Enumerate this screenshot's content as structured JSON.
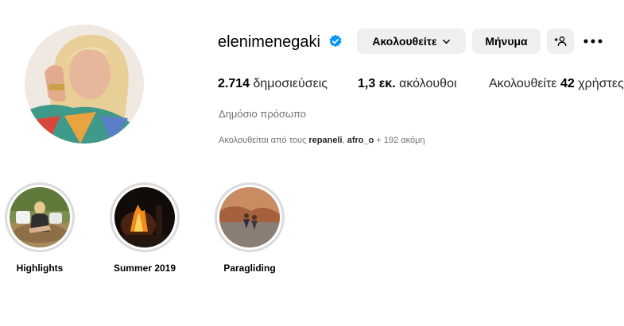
{
  "profile": {
    "username": "elenimenegaki",
    "verified": true,
    "accent_color": "#0095f6",
    "avatar_icon": "profile-photo"
  },
  "actions": {
    "follow_label": "Ακολουθείτε",
    "message_label": "Μήνυμα",
    "add_user_icon": "person-add-icon",
    "more_icon": "more-options-icon"
  },
  "stats": {
    "posts_count": "2.714",
    "posts_label": "δημοσιεύσεις",
    "followers_count": "1,3 εκ.",
    "followers_label": "ακόλουθοι",
    "following_prefix": "Ακολουθείτε",
    "following_count": "42",
    "following_label": "χρήστες"
  },
  "bio": {
    "category": "Δημόσιο πρόσωπο",
    "followed_by_prefix": "Ακολουθείται από τους",
    "followed_by_user1": "repaneli",
    "followed_by_sep": ",",
    "followed_by_user2": "afro_o",
    "followed_by_suffix": "+ 192 ακόμη"
  },
  "highlights": [
    {
      "label": "Highlights"
    },
    {
      "label": "Summer 2019"
    },
    {
      "label": "Paragliding"
    }
  ]
}
